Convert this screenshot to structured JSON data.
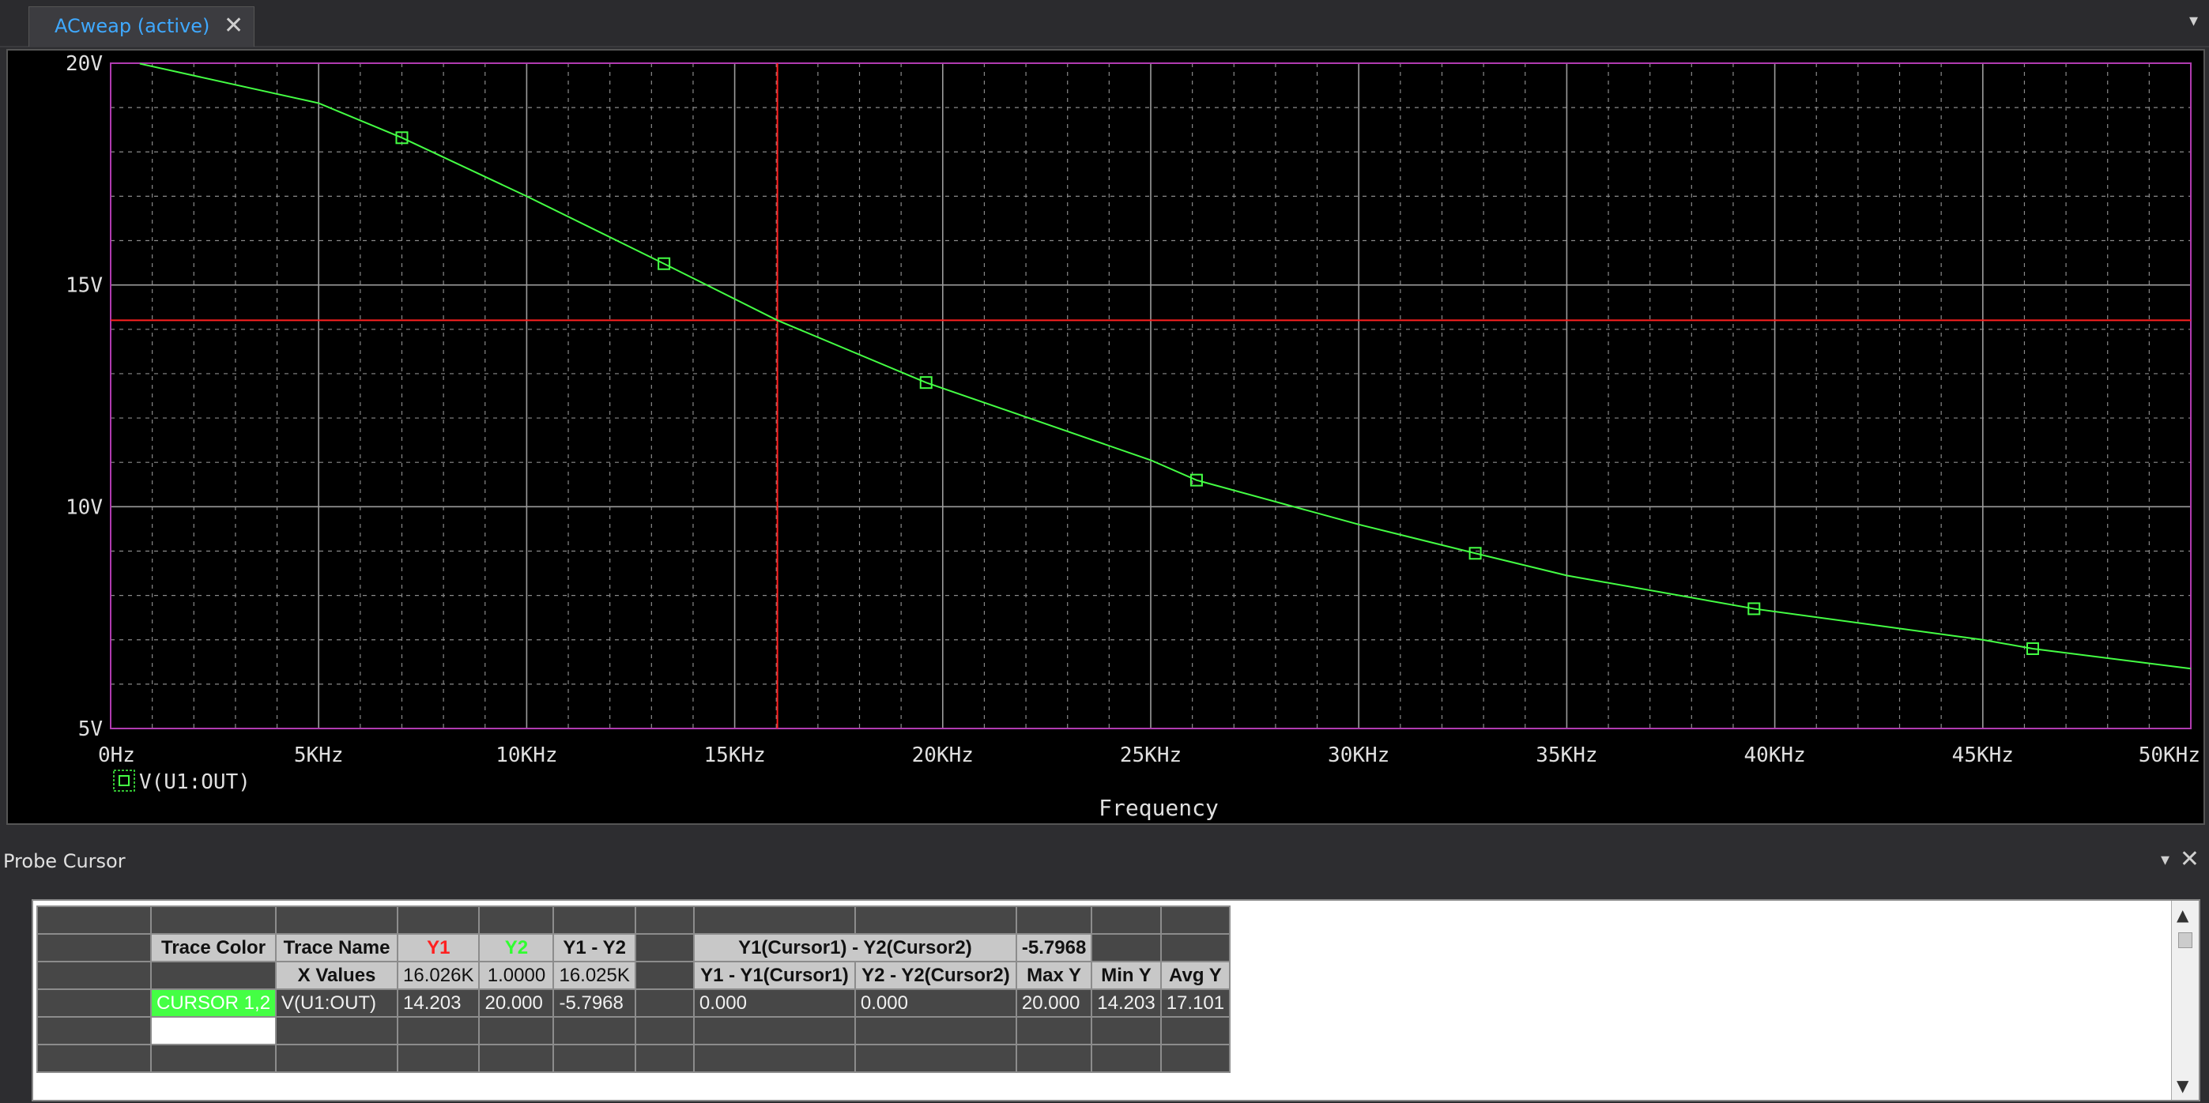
{
  "tab": {
    "label": "ACweap (active)",
    "close": "✕",
    "menu": "▾"
  },
  "chart_data": {
    "type": "line",
    "xlabel": "Frequency",
    "ylabel": "",
    "xlim": [
      0,
      50000
    ],
    "ylim": [
      5,
      20
    ],
    "x_ticks": [
      "0Hz",
      "5KHz",
      "10KHz",
      "15KHz",
      "20KHz",
      "25KHz",
      "30KHz",
      "35KHz",
      "40KHz",
      "45KHz",
      "50KHz"
    ],
    "y_ticks": [
      "20V",
      "15V",
      "10V",
      "5V"
    ],
    "grid": true,
    "series": [
      {
        "name": "V(U1:OUT)",
        "color": "#44ff44",
        "x": [
          700,
          5000,
          7000,
          10000,
          13300,
          16026,
          19600,
          25000,
          26100,
          30000,
          32800,
          35000,
          39500,
          45000,
          46200,
          50000
        ],
        "y": [
          19.99,
          19.1,
          18.32,
          17.0,
          15.48,
          14.203,
          12.8,
          11.05,
          10.6,
          9.6,
          8.95,
          8.45,
          7.7,
          7.0,
          6.8,
          6.35
        ],
        "markers_x": [
          7000,
          13300,
          19600,
          26100,
          32800,
          39500,
          46200
        ]
      }
    ],
    "cursors": {
      "x": 16026,
      "y": 14.203,
      "color": "#ff2020"
    }
  },
  "probe": {
    "title": "Probe Cursor",
    "pin": "▾",
    "close": "✕",
    "headers": {
      "trace_color": "Trace Color",
      "trace_name": "Trace Name",
      "y1": "Y1",
      "y2": "Y2",
      "y1_y2": "Y1 - Y2",
      "diff_cursor": "Y1(Cursor1) - Y2(Cursor2)",
      "diff_value": "-5.7968",
      "x_values": "X Values",
      "x_y1": "16.026K",
      "x_y2": "1.0000",
      "x_diff": "16.025K",
      "y1_minus": "Y1 - Y1(Cursor1)",
      "y2_minus": "Y2 - Y2(Cursor2)",
      "max_y": "Max Y",
      "min_y": "Min Y",
      "avg_y": "Avg Y"
    },
    "row": {
      "trace_color": "CURSOR 1,2",
      "trace_name": "V(U1:OUT)",
      "y1": "14.203",
      "y2": "20.000",
      "y1_y2": "-5.7968",
      "y1_minus": "0.000",
      "y2_minus": "0.000",
      "max_y": "20.000",
      "min_y": "14.203",
      "avg_y": "17.101"
    },
    "scroll_up": "▲",
    "scroll_down": "▼"
  }
}
